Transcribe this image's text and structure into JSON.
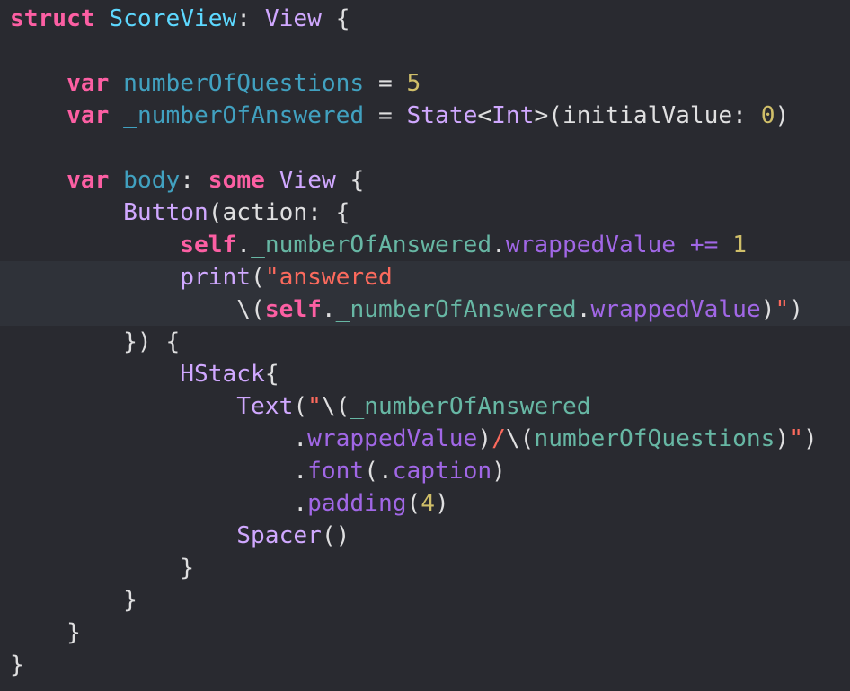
{
  "theme": {
    "background": "#292a30",
    "current_line_highlight": "#2f3239",
    "colors": {
      "keyword": "#fc5fa3",
      "type_declaration": "#5dd8ff",
      "other_type": "#d0a8ff",
      "project_property": "#41a1c0",
      "system_property": "#a167e6",
      "project_identifier": "#67b7a4",
      "number": "#d0bf69",
      "string": "#fc6a5d",
      "plain_text": "#dfdfe0"
    }
  },
  "code": {
    "lines": [
      [
        {
          "t": "struct",
          "c": "kw"
        },
        {
          "t": " ",
          "c": "plain"
        },
        {
          "t": "ScoreView",
          "c": "typedecl"
        },
        {
          "t": ": ",
          "c": "plain"
        },
        {
          "t": "View",
          "c": "typeref"
        },
        {
          "t": " {",
          "c": "plain"
        }
      ],
      [],
      [
        {
          "t": "    ",
          "c": "plain"
        },
        {
          "t": "var",
          "c": "kw"
        },
        {
          "t": " ",
          "c": "plain"
        },
        {
          "t": "numberOfQuestions",
          "c": "prop"
        },
        {
          "t": " = ",
          "c": "plain"
        },
        {
          "t": "5",
          "c": "num"
        }
      ],
      [
        {
          "t": "    ",
          "c": "plain"
        },
        {
          "t": "var",
          "c": "kw"
        },
        {
          "t": " ",
          "c": "plain"
        },
        {
          "t": "_numberOfAnswered",
          "c": "prop"
        },
        {
          "t": " = ",
          "c": "plain"
        },
        {
          "t": "State",
          "c": "typeref"
        },
        {
          "t": "<",
          "c": "plain"
        },
        {
          "t": "Int",
          "c": "typeref"
        },
        {
          "t": ">(initialValue: ",
          "c": "plain"
        },
        {
          "t": "0",
          "c": "num"
        },
        {
          "t": ")",
          "c": "plain"
        }
      ],
      [],
      [
        {
          "t": "    ",
          "c": "plain"
        },
        {
          "t": "var",
          "c": "kw"
        },
        {
          "t": " ",
          "c": "plain"
        },
        {
          "t": "body",
          "c": "prop"
        },
        {
          "t": ": ",
          "c": "plain"
        },
        {
          "t": "some",
          "c": "kw"
        },
        {
          "t": " ",
          "c": "plain"
        },
        {
          "t": "View",
          "c": "typeref"
        },
        {
          "t": " {",
          "c": "plain"
        }
      ],
      [
        {
          "t": "        ",
          "c": "plain"
        },
        {
          "t": "Button",
          "c": "typeref"
        },
        {
          "t": "(action: {",
          "c": "plain"
        }
      ],
      [
        {
          "t": "            ",
          "c": "plain"
        },
        {
          "t": "self",
          "c": "kw"
        },
        {
          "t": ".",
          "c": "plain"
        },
        {
          "t": "_numberOfAnswered",
          "c": "ident"
        },
        {
          "t": ".",
          "c": "plain"
        },
        {
          "t": "wrappedValue",
          "c": "sysprop"
        },
        {
          "t": " ",
          "c": "plain"
        },
        {
          "t": "+=",
          "c": "sysprop"
        },
        {
          "t": " ",
          "c": "plain"
        },
        {
          "t": "1",
          "c": "num"
        }
      ],
      [
        {
          "t": "            ",
          "c": "plain"
        },
        {
          "t": "print",
          "c": "typeref"
        },
        {
          "t": "(",
          "c": "plain"
        },
        {
          "t": "\"answered",
          "c": "str"
        }
      ],
      [
        {
          "t": "                ",
          "c": "plain"
        },
        {
          "t": "\\(",
          "c": "plain"
        },
        {
          "t": "self",
          "c": "kw"
        },
        {
          "t": ".",
          "c": "plain"
        },
        {
          "t": "_numberOfAnswered",
          "c": "ident"
        },
        {
          "t": ".",
          "c": "plain"
        },
        {
          "t": "wrappedValue",
          "c": "sysprop"
        },
        {
          "t": ")",
          "c": "plain"
        },
        {
          "t": "\"",
          "c": "str"
        },
        {
          "t": ")",
          "c": "plain"
        }
      ],
      [
        {
          "t": "        ",
          "c": "plain"
        },
        {
          "t": "}) {",
          "c": "plain"
        }
      ],
      [
        {
          "t": "            ",
          "c": "plain"
        },
        {
          "t": "HStack",
          "c": "typeref"
        },
        {
          "t": "{",
          "c": "plain"
        }
      ],
      [
        {
          "t": "                ",
          "c": "plain"
        },
        {
          "t": "Text",
          "c": "typeref"
        },
        {
          "t": "(",
          "c": "plain"
        },
        {
          "t": "\"",
          "c": "str"
        },
        {
          "t": "\\(",
          "c": "plain"
        },
        {
          "t": "_numberOfAnswered",
          "c": "ident"
        }
      ],
      [
        {
          "t": "                    ",
          "c": "plain"
        },
        {
          "t": ".",
          "c": "plain"
        },
        {
          "t": "wrappedValue",
          "c": "sysprop"
        },
        {
          "t": ")",
          "c": "plain"
        },
        {
          "t": "/",
          "c": "str"
        },
        {
          "t": "\\(",
          "c": "plain"
        },
        {
          "t": "numberOfQuestions",
          "c": "ident"
        },
        {
          "t": ")",
          "c": "plain"
        },
        {
          "t": "\"",
          "c": "str"
        },
        {
          "t": ")",
          "c": "plain"
        }
      ],
      [
        {
          "t": "                    ",
          "c": "plain"
        },
        {
          "t": ".",
          "c": "plain"
        },
        {
          "t": "font",
          "c": "sysprop"
        },
        {
          "t": "(.",
          "c": "plain"
        },
        {
          "t": "caption",
          "c": "sysprop"
        },
        {
          "t": ")",
          "c": "plain"
        }
      ],
      [
        {
          "t": "                    ",
          "c": "plain"
        },
        {
          "t": ".",
          "c": "plain"
        },
        {
          "t": "padding",
          "c": "sysprop"
        },
        {
          "t": "(",
          "c": "plain"
        },
        {
          "t": "4",
          "c": "num"
        },
        {
          "t": ")",
          "c": "plain"
        }
      ],
      [
        {
          "t": "                ",
          "c": "plain"
        },
        {
          "t": "Spacer",
          "c": "typeref"
        },
        {
          "t": "()",
          "c": "plain"
        }
      ],
      [
        {
          "t": "            ",
          "c": "plain"
        },
        {
          "t": "}",
          "c": "plain"
        }
      ],
      [
        {
          "t": "        ",
          "c": "plain"
        },
        {
          "t": "}",
          "c": "plain"
        }
      ],
      [
        {
          "t": "    ",
          "c": "plain"
        },
        {
          "t": "}",
          "c": "plain"
        }
      ],
      [
        {
          "t": "}",
          "c": "plain"
        }
      ]
    ]
  }
}
